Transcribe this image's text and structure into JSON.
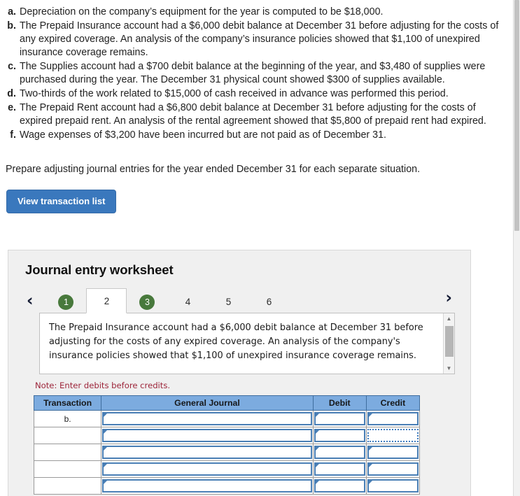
{
  "situations": [
    {
      "letter": "a.",
      "text": "Depreciation on the company’s equipment for the year is computed to be $18,000."
    },
    {
      "letter": "b.",
      "text": "The Prepaid Insurance account had a $6,000 debit balance at December 31 before adjusting for the costs of any expired coverage. An analysis of the company’s insurance policies showed that $1,100 of unexpired insurance coverage remains."
    },
    {
      "letter": "c.",
      "text": "The Supplies account had a $700 debit balance at the beginning of the year, and $3,480 of supplies were purchased during the year. The December 31 physical count showed $300 of supplies available."
    },
    {
      "letter": "d.",
      "text": "Two-thirds of the work related to $15,000 of cash received in advance was performed this period."
    },
    {
      "letter": "e.",
      "text": "The Prepaid Rent account had a $6,800 debit balance at December 31 before adjusting for the costs of expired prepaid rent. An analysis of the rental agreement showed that $5,800 of prepaid rent had expired."
    },
    {
      "letter": "f.",
      "text": "Wage expenses of $3,200 have been incurred but are not paid as of December 31."
    }
  ],
  "instruction": "Prepare adjusting journal entries for the year ended December 31 for each separate situation.",
  "buttons": {
    "view_transaction_list": "View transaction list"
  },
  "worksheet": {
    "title": "Journal entry worksheet",
    "nav": {
      "prev_icon": "‹",
      "next_icon": "›"
    },
    "tabs": [
      {
        "label": "1",
        "state": "done"
      },
      {
        "label": "2",
        "state": "active"
      },
      {
        "label": "3",
        "state": "done"
      },
      {
        "label": "4",
        "state": "normal"
      },
      {
        "label": "5",
        "state": "normal"
      },
      {
        "label": "6",
        "state": "normal"
      }
    ],
    "description": "The Prepaid Insurance account had a $6,000 debit balance at December 31 before adjusting for the costs of any expired coverage. An analysis of the company's insurance policies showed that $1,100 of unexpired insurance coverage remains.",
    "scrollbar": {
      "up_icon": "▲",
      "down_icon": "▼"
    },
    "note": "Note: Enter debits before credits.",
    "table": {
      "headers": [
        "Transaction",
        "General Journal",
        "Debit",
        "Credit"
      ],
      "rows": [
        {
          "transaction": "b.",
          "general_journal": "",
          "debit": "",
          "credit": "",
          "focused": ""
        },
        {
          "transaction": "",
          "general_journal": "",
          "debit": "",
          "credit": "",
          "focused": "credit"
        },
        {
          "transaction": "",
          "general_journal": "",
          "debit": "",
          "credit": "",
          "focused": ""
        },
        {
          "transaction": "",
          "general_journal": "",
          "debit": "",
          "credit": "",
          "focused": ""
        },
        {
          "transaction": "",
          "general_journal": "",
          "debit": "",
          "credit": "",
          "focused": ""
        }
      ]
    }
  },
  "colors": {
    "button_blue": "#3a78bd",
    "tab_green": "#48793c",
    "header_blue": "#7cabdf",
    "note_red": "#9c2439",
    "cell_border_blue": "#4a7fb5"
  }
}
